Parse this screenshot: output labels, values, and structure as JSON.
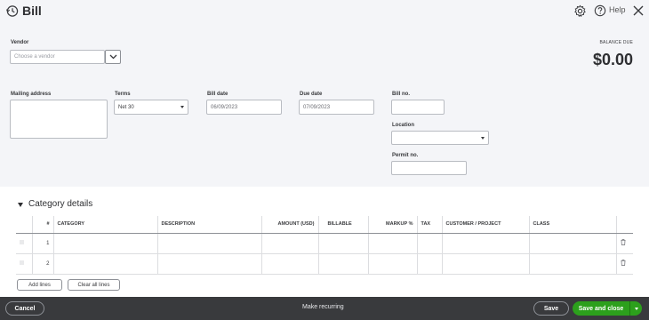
{
  "header": {
    "title": "Bill",
    "help_label": "Help"
  },
  "form": {
    "vendor_label": "Vendor",
    "vendor_placeholder": "Choose a vendor",
    "balance_due_label": "BALANCE DUE",
    "balance_due_value": "$0.00",
    "mailing_address_label": "Mailing address",
    "terms_label": "Terms",
    "terms_value": "Net 30",
    "bill_date_label": "Bill date",
    "bill_date_value": "06/09/2023",
    "due_date_label": "Due date",
    "due_date_value": "07/09/2023",
    "bill_no_label": "Bill no.",
    "location_label": "Location",
    "permit_no_label": "Permit no."
  },
  "category": {
    "title": "Category details",
    "columns": [
      "#",
      "CATEGORY",
      "DESCRIPTION",
      "AMOUNT (USD)",
      "BILLABLE",
      "MARKUP %",
      "TAX",
      "CUSTOMER / PROJECT",
      "CLASS"
    ],
    "rows": [
      {
        "num": "1"
      },
      {
        "num": "2"
      }
    ],
    "add_lines_label": "Add lines",
    "clear_all_lines_label": "Clear all lines"
  },
  "footer": {
    "cancel_label": "Cancel",
    "make_recurring_label": "Make recurring",
    "save_label": "Save",
    "save_and_close_label": "Save and close"
  },
  "colors": {
    "primary_green": "#2ca01c",
    "footer_bg": "#393a3d",
    "page_bg": "#f4f5f8"
  }
}
